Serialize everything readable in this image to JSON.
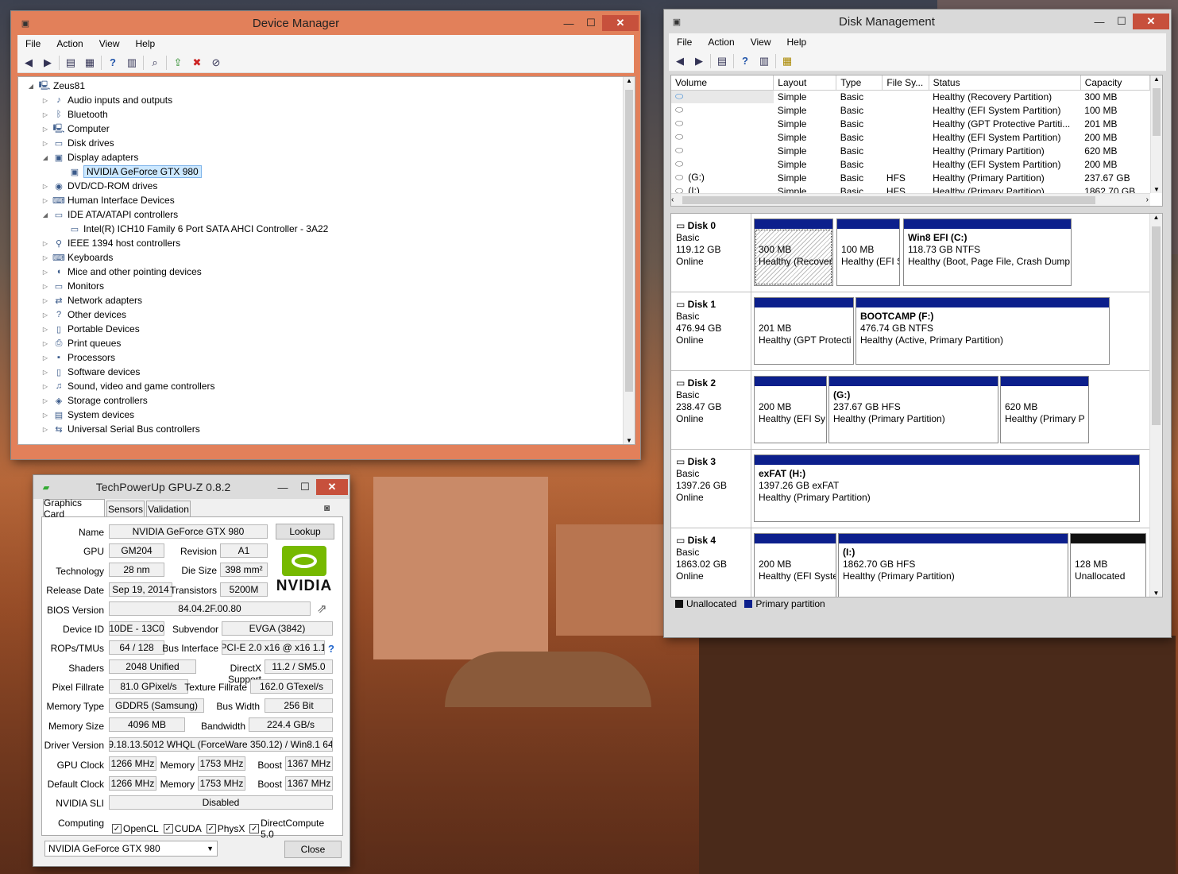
{
  "device_manager": {
    "title": "Device Manager",
    "menu": [
      "File",
      "Action",
      "View",
      "Help"
    ],
    "root": "Zeus81",
    "items": [
      {
        "label": "Audio inputs and outputs",
        "icon": "speaker-icon",
        "exp": "collapsed",
        "level": 1
      },
      {
        "label": "Bluetooth",
        "icon": "bluetooth-icon",
        "exp": "collapsed",
        "level": 1
      },
      {
        "label": "Computer",
        "icon": "computer-icon",
        "exp": "collapsed",
        "level": 1
      },
      {
        "label": "Disk drives",
        "icon": "disk-icon",
        "exp": "collapsed",
        "level": 1
      },
      {
        "label": "Display adapters",
        "icon": "display-adapter-icon",
        "exp": "expanded",
        "level": 1
      },
      {
        "label": "NVIDIA GeForce GTX 980",
        "icon": "display-adapter-icon",
        "exp": "none",
        "level": 2,
        "selected": true
      },
      {
        "label": "DVD/CD-ROM drives",
        "icon": "dvd-icon",
        "exp": "collapsed",
        "level": 1
      },
      {
        "label": "Human Interface Devices",
        "icon": "hid-icon",
        "exp": "collapsed",
        "level": 1
      },
      {
        "label": "IDE ATA/ATAPI controllers",
        "icon": "ide-icon",
        "exp": "expanded",
        "level": 1
      },
      {
        "label": "Intel(R) ICH10 Family 6 Port SATA AHCI Controller - 3A22",
        "icon": "ide-icon",
        "exp": "none",
        "level": 2
      },
      {
        "label": "IEEE 1394 host controllers",
        "icon": "ieee1394-icon",
        "exp": "collapsed",
        "level": 1
      },
      {
        "label": "Keyboards",
        "icon": "keyboard-icon",
        "exp": "collapsed",
        "level": 1
      },
      {
        "label": "Mice and other pointing devices",
        "icon": "mouse-icon",
        "exp": "collapsed",
        "level": 1
      },
      {
        "label": "Monitors",
        "icon": "monitor-icon",
        "exp": "collapsed",
        "level": 1
      },
      {
        "label": "Network adapters",
        "icon": "network-icon",
        "exp": "collapsed",
        "level": 1
      },
      {
        "label": "Other devices",
        "icon": "other-devices-icon",
        "exp": "collapsed",
        "level": 1
      },
      {
        "label": "Portable Devices",
        "icon": "portable-device-icon",
        "exp": "collapsed",
        "level": 1
      },
      {
        "label": "Print queues",
        "icon": "printer-icon",
        "exp": "collapsed",
        "level": 1
      },
      {
        "label": "Processors",
        "icon": "processor-icon",
        "exp": "collapsed",
        "level": 1
      },
      {
        "label": "Software devices",
        "icon": "software-device-icon",
        "exp": "collapsed",
        "level": 1
      },
      {
        "label": "Sound, video and game controllers",
        "icon": "sound-icon",
        "exp": "collapsed",
        "level": 1
      },
      {
        "label": "Storage controllers",
        "icon": "storage-icon",
        "exp": "collapsed",
        "level": 1
      },
      {
        "label": "System devices",
        "icon": "system-icon",
        "exp": "collapsed",
        "level": 1
      },
      {
        "label": "Universal Serial Bus controllers",
        "icon": "usb-icon",
        "exp": "collapsed",
        "level": 1
      }
    ]
  },
  "disk_management": {
    "title": "Disk Management",
    "menu": [
      "File",
      "Action",
      "View",
      "Help"
    ],
    "columns": [
      "Volume",
      "Layout",
      "Type",
      "File Sy...",
      "Status",
      "Capacity"
    ],
    "volumes": [
      {
        "volume": "",
        "layout": "Simple",
        "type": "Basic",
        "fs": "",
        "status": "Healthy (Recovery Partition)",
        "capacity": "300 MB"
      },
      {
        "volume": "",
        "layout": "Simple",
        "type": "Basic",
        "fs": "",
        "status": "Healthy (EFI System Partition)",
        "capacity": "100 MB"
      },
      {
        "volume": "",
        "layout": "Simple",
        "type": "Basic",
        "fs": "",
        "status": "Healthy (GPT Protective Partiti...",
        "capacity": "201 MB"
      },
      {
        "volume": "",
        "layout": "Simple",
        "type": "Basic",
        "fs": "",
        "status": "Healthy (EFI System Partition)",
        "capacity": "200 MB"
      },
      {
        "volume": "",
        "layout": "Simple",
        "type": "Basic",
        "fs": "",
        "status": "Healthy (Primary Partition)",
        "capacity": "620 MB"
      },
      {
        "volume": "",
        "layout": "Simple",
        "type": "Basic",
        "fs": "",
        "status": "Healthy (EFI System Partition)",
        "capacity": "200 MB"
      },
      {
        "volume": "(G:)",
        "layout": "Simple",
        "type": "Basic",
        "fs": "HFS",
        "status": "Healthy (Primary Partition)",
        "capacity": "237.67 GB"
      },
      {
        "volume": "(I:)",
        "layout": "Simple",
        "type": "Basic",
        "fs": "HFS",
        "status": "Healthy (Primary Partition)",
        "capacity": "1862.70 GB"
      }
    ],
    "disks": [
      {
        "name": "Disk 0",
        "type": "Basic",
        "size": "119.12 GB",
        "state": "Online",
        "parts": [
          {
            "l1": "",
            "l2": "300 MB",
            "l3": "Healthy (Recover",
            "hatch": true
          },
          {
            "l1": "",
            "l2": "100 MB",
            "l3": "Healthy (EFI S"
          },
          {
            "l1": "Win8 EFI  (C:)",
            "l2": "118.73 GB NTFS",
            "l3": "Healthy (Boot, Page File, Crash Dump"
          }
        ]
      },
      {
        "name": "Disk 1",
        "type": "Basic",
        "size": "476.94 GB",
        "state": "Online",
        "parts": [
          {
            "l1": "",
            "l2": "201 MB",
            "l3": "Healthy (GPT Protecti"
          },
          {
            "l1": "BOOTCAMP  (F:)",
            "l2": "476.74 GB NTFS",
            "l3": "Healthy (Active, Primary Partition)"
          }
        ]
      },
      {
        "name": "Disk 2",
        "type": "Basic",
        "size": "238.47 GB",
        "state": "Online",
        "parts": [
          {
            "l1": "",
            "l2": "200 MB",
            "l3": "Healthy (EFI Sy"
          },
          {
            "l1": "(G:)",
            "l2": "237.67 GB HFS",
            "l3": "Healthy (Primary Partition)"
          },
          {
            "l1": "",
            "l2": "620 MB",
            "l3": "Healthy (Primary P"
          }
        ]
      },
      {
        "name": "Disk 3",
        "type": "Basic",
        "size": "1397.26 GB",
        "state": "Online",
        "parts": [
          {
            "l1": "exFAT  (H:)",
            "l2": "1397.26 GB exFAT",
            "l3": "Healthy (Primary Partition)"
          }
        ]
      },
      {
        "name": "Disk 4",
        "type": "Basic",
        "size": "1863.02 GB",
        "state": "Online",
        "parts": [
          {
            "l1": "",
            "l2": "200 MB",
            "l3": "Healthy (EFI Syste"
          },
          {
            "l1": "(I:)",
            "l2": "1862.70 GB HFS",
            "l3": "Healthy (Primary Partition)"
          },
          {
            "l1": "",
            "l2": "128 MB",
            "l3": "Unallocated",
            "black": true
          }
        ]
      }
    ],
    "legend": {
      "unallocated": "Unallocated",
      "primary": "Primary partition"
    },
    "colors": {
      "primary": "#0c1f8c",
      "unallocated": "#111111"
    }
  },
  "gpuz": {
    "title": "TechPowerUp GPU-Z 0.8.2",
    "tabs": [
      "Graphics Card",
      "Sensors",
      "Validation"
    ],
    "labels": {
      "name": "Name",
      "gpu": "GPU",
      "revision": "Revision",
      "technology": "Technology",
      "die_size": "Die Size",
      "release_date": "Release Date",
      "transistors": "Transistors",
      "bios": "BIOS Version",
      "device_id": "Device ID",
      "subvendor": "Subvendor",
      "rops": "ROPs/TMUs",
      "bus_interface": "Bus Interface",
      "shaders": "Shaders",
      "directx": "DirectX Support",
      "pixel_fillrate": "Pixel Fillrate",
      "texture_fillrate": "Texture Fillrate",
      "memory_type": "Memory Type",
      "bus_width": "Bus Width",
      "memory_size": "Memory Size",
      "bandwidth": "Bandwidth",
      "driver": "Driver Version",
      "gpu_clock": "GPU Clock",
      "memory": "Memory",
      "boost": "Boost",
      "default_clock": "Default Clock",
      "sli": "NVIDIA SLI",
      "computing": "Computing"
    },
    "values": {
      "name": "NVIDIA GeForce GTX 980",
      "gpu": "GM204",
      "revision": "A1",
      "technology": "28 nm",
      "die_size": "398 mm²",
      "release_date": "Sep 19, 2014",
      "transistors": "5200M",
      "bios": "84.04.2F.00.80",
      "device_id": "10DE - 13C0",
      "subvendor": "EVGA (3842)",
      "rops": "64 / 128",
      "bus_interface": "PCI-E 2.0 x16 @ x16 1.1",
      "shaders": "2048 Unified",
      "directx": "11.2 / SM5.0",
      "pixel_fillrate": "81.0 GPixel/s",
      "texture_fillrate": "162.0 GTexel/s",
      "memory_type": "GDDR5 (Samsung)",
      "bus_width": "256 Bit",
      "memory_size": "4096 MB",
      "bandwidth": "224.4 GB/s",
      "driver": "9.18.13.5012 WHQL (ForceWare 350.12) / Win8.1 64",
      "gpu_clock": "1266 MHz",
      "gpu_mem": "1753 MHz",
      "gpu_boost": "1367 MHz",
      "def_clock": "1266 MHz",
      "def_mem": "1753 MHz",
      "def_boost": "1367 MHz",
      "sli": "Disabled"
    },
    "computing": [
      "OpenCL",
      "CUDA",
      "PhysX",
      "DirectCompute 5.0"
    ],
    "lookup": "Lookup",
    "logo": "NVIDIA",
    "question": "?",
    "selector": "NVIDIA GeForce GTX 980",
    "close": "Close"
  }
}
